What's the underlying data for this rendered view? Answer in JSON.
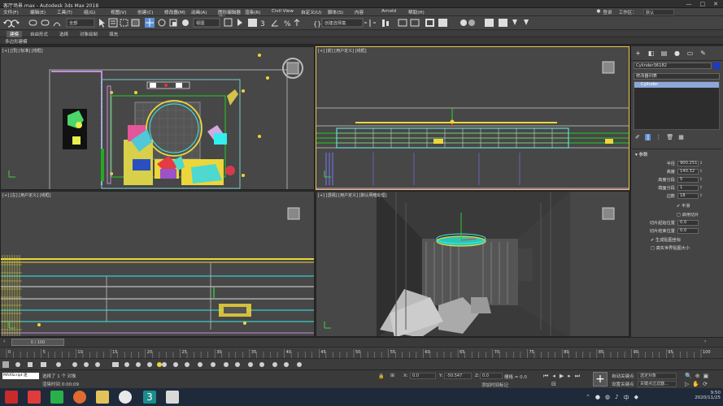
{
  "titlebar": {
    "title": "客厅场景.max - Autodesk 3ds Max 2018",
    "window_controls": [
      "—",
      "□",
      "✕"
    ]
  },
  "menubar": {
    "items": [
      "文件(F)",
      "编辑(E)",
      "工具(T)",
      "组(G)",
      "视图(V)",
      "创建(C)",
      "修改器(M)",
      "动画(A)",
      "图形编辑器(D)",
      "渲染(R)",
      "Civil View",
      "自定义(U)",
      "脚本(S)",
      "内容",
      "Arnold",
      "帮助(H)"
    ],
    "login": "登录",
    "workspace_label": "工作区：",
    "workspace_value": "默认"
  },
  "toolbar": {
    "selection_filter": "全部",
    "view_dropdown": "视图",
    "named_selection": "创建选择集"
  },
  "ribbon": {
    "tabs": [
      "建模",
      "自由形式",
      "选择",
      "对象绘制",
      "填充"
    ],
    "active_tab": "建模",
    "sub_label": "多边形建模"
  },
  "viewports": {
    "top_label": "[+] [顶] [标准] [线框]",
    "front_label": "[+] [前] [用户定义] [线框]",
    "left_label": "[+] [左] [用户定义] [线框]",
    "persp_label": "[+] [透视] [用户定义] [默认明暗处理]"
  },
  "command_panel": {
    "tab_icons": [
      "+",
      "create-icon",
      "hierarchy-icon",
      "motion-icon",
      "display-icon",
      "utilities-icon"
    ],
    "object_name": "Cylinder36182",
    "modifier_list": "修改器列表",
    "stack_item": "Cylinder",
    "rollout_title": "参数",
    "params": [
      {
        "label": "半径",
        "value": "900.251"
      },
      {
        "label": "高度",
        "value": "140.32"
      },
      {
        "label": "高度分段",
        "value": "5"
      },
      {
        "label": "端面分段",
        "value": "1"
      },
      {
        "label": "边数",
        "value": "18"
      }
    ],
    "smooth_label": "平滑",
    "slice_label": "启用切片",
    "slice_from_label": "切片起始位置",
    "slice_to_label": "切片结束位置",
    "slice_from_value": "0.0",
    "slice_to_value": "0.0",
    "gen_uv_label": "生成贴图坐标",
    "real_world_label": "真实世界贴图大小"
  },
  "timeline": {
    "frame_label": "0 / 100",
    "ruler_ticks": [
      "0",
      "5",
      "10",
      "15",
      "20",
      "25",
      "30",
      "35",
      "40",
      "45",
      "50",
      "55",
      "60",
      "65",
      "70",
      "75",
      "80",
      "85",
      "90",
      "95",
      "100"
    ]
  },
  "status": {
    "maxscript": "MAXScript 迷",
    "selection": "选择了 1 个 对象",
    "render_time": "渲染时间 0:00:09",
    "x_label": "X:",
    "x_value": "0.0",
    "y_label": "Y:",
    "y_value": "-50.547",
    "z_label": "Z:",
    "z_value": "0.0",
    "grid": "栅格 = 0.0",
    "add_time_tag": "添加时间标记",
    "auto_key": "自动关键点",
    "selected_object": "选定对象",
    "set_key": "设置关键点",
    "key_filter": "关键点过滤器..."
  },
  "taskbar": {
    "time": "9:50",
    "date": "2020/11/25"
  },
  "colors": {
    "viewport_bg": "#474747",
    "active_border": "#e7c84a",
    "accent_yellow": "#ecd63a",
    "cyan": "#4fe3e3"
  }
}
